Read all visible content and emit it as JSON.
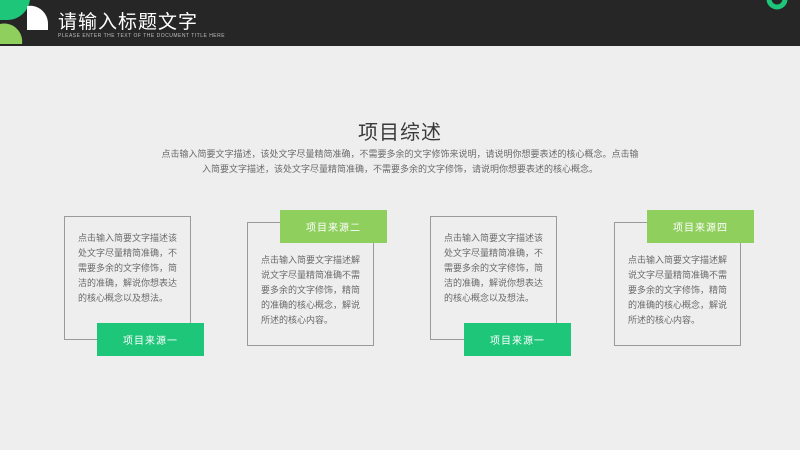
{
  "header": {
    "title": "请输入标题文字",
    "subtitle": "PLEASE ENTER THE TEXT OF THE DOCUMENT TITLE HERE"
  },
  "colors": {
    "accent_dark": "#1dc679",
    "accent_light": "#8fcf5e",
    "header_bg": "#262626",
    "background": "#eeeeee"
  },
  "section": {
    "title": "项目综述",
    "description": "点击输入简要文字描述，该处文字尽量精简准确，不需要多余的文字修饰来说明，请说明你想要表述的核心概念。点击输入简要文字描述，该处文字尽量精简准确，不需要多余的文字修饰，请说明你想要表述的核心概念。"
  },
  "cards": [
    {
      "text": "点击输入简要文字描述该处文字尽量精简准确，不需要多余的文字修饰，简洁的准确，解说你想表达的核心概念以及想法。",
      "tag": "项目来源一"
    },
    {
      "text": "点击输入简要文字描述解说文字尽量精简准确不需要多余的文字修饰，精简的准确的核心概念，解说所述的核心内容。",
      "tag": "项目来源二"
    },
    {
      "text": "点击输入简要文字描述该处文字尽量精简准确，不需要多余的文字修饰，简洁的准确，解说你想表达的核心概念以及想法。",
      "tag": "项目来源一"
    },
    {
      "text": "点击输入简要文字描述解说文字尽量精简准确不需要多余的文字修饰，精简的准确的核心概念，解说所述的核心内容。",
      "tag": "项目来源四"
    }
  ]
}
